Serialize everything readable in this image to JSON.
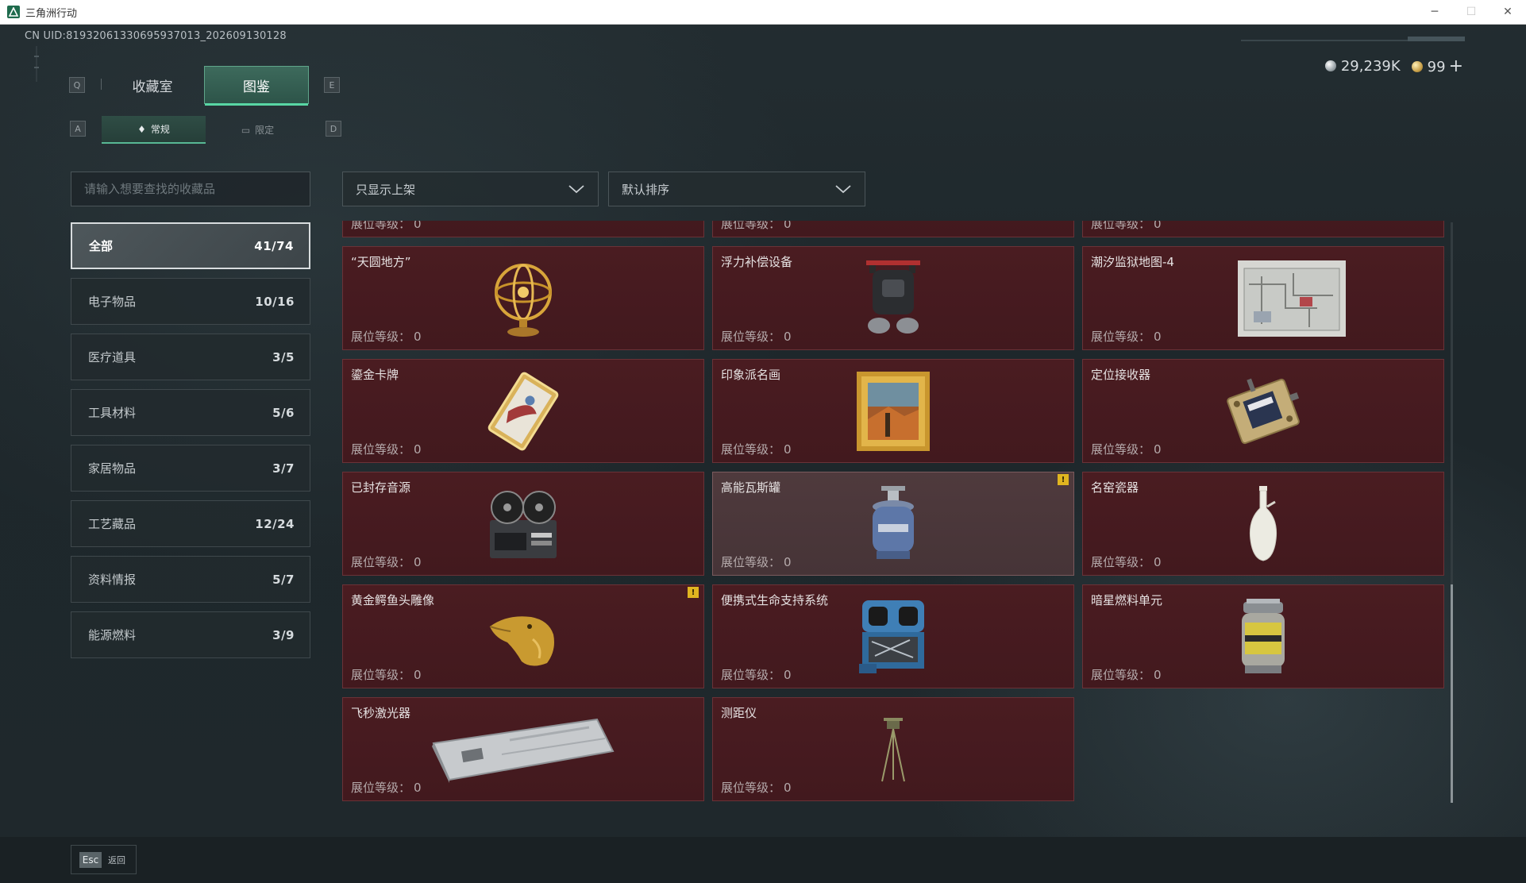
{
  "window": {
    "title": "三角洲行动",
    "controls": {
      "minimize": "─",
      "maximize": "☐",
      "close": "✕"
    }
  },
  "uid": "CN UID:81932061330695937013_202609130128",
  "currency": {
    "silver": "29,239K",
    "gold": "99",
    "add": "+"
  },
  "main_tabs": {
    "left_key": "Q",
    "right_key": "E",
    "items": [
      {
        "label": "收藏室",
        "active": false
      },
      {
        "label": "图鉴",
        "active": true
      }
    ]
  },
  "sub_tabs": {
    "left_key": "A",
    "right_key": "D",
    "items": [
      {
        "label": "常规",
        "icon": "item-icon",
        "active": true
      },
      {
        "label": "限定",
        "icon": "image-icon",
        "active": false
      }
    ]
  },
  "search": {
    "placeholder": "请输入想要查找的收藏品",
    "value": ""
  },
  "filters": {
    "shelf_filter": "只显示上架",
    "sort": "默认排序"
  },
  "categories": [
    {
      "label": "全部",
      "count": "41/74",
      "active": true
    },
    {
      "label": "电子物品",
      "count": "10/16"
    },
    {
      "label": "医疗道具",
      "count": "3/5"
    },
    {
      "label": "工具材料",
      "count": "5/6"
    },
    {
      "label": "家居物品",
      "count": "3/7"
    },
    {
      "label": "工艺藏品",
      "count": "12/24"
    },
    {
      "label": "资料情报",
      "count": "5/7"
    },
    {
      "label": "能源燃料",
      "count": "3/9"
    }
  ],
  "level_label": "展位等级：",
  "items": [
    {
      "name": "",
      "level": "0",
      "icon": "partial-item"
    },
    {
      "name": "",
      "level": "0",
      "icon": "partial-item"
    },
    {
      "name": "",
      "level": "0",
      "icon": "partial-item"
    },
    {
      "name": "“天圆地方”",
      "level": "0",
      "icon": "armillary-sphere-icon"
    },
    {
      "name": "浮力补偿设备",
      "level": "0",
      "icon": "buoyancy-device-icon"
    },
    {
      "name": "潮汐监狱地图-4",
      "level": "0",
      "icon": "map-icon"
    },
    {
      "name": "鎏金卡牌",
      "level": "0",
      "icon": "gold-card-icon"
    },
    {
      "name": "印象派名画",
      "level": "0",
      "icon": "painting-icon"
    },
    {
      "name": "定位接收器",
      "level": "0",
      "icon": "receiver-icon"
    },
    {
      "name": "已封存音源",
      "level": "0",
      "icon": "reel-recorder-icon"
    },
    {
      "name": "高能瓦斯罐",
      "level": "0",
      "icon": "gas-canister-icon",
      "badge": "!",
      "hover": true
    },
    {
      "name": "名窑瓷器",
      "level": "0",
      "icon": "porcelain-vase-icon"
    },
    {
      "name": "黄金鳄鱼头雕像",
      "level": "0",
      "icon": "crocodile-statue-icon",
      "badge": "!"
    },
    {
      "name": "便携式生命支持系统",
      "level": "0",
      "icon": "life-support-icon"
    },
    {
      "name": "暗星燃料单元",
      "level": "0",
      "icon": "fuel-cell-icon"
    },
    {
      "name": "飞秒激光器",
      "level": "0",
      "icon": "laser-device-icon"
    },
    {
      "name": "测距仪",
      "level": "0",
      "icon": "rangefinder-icon"
    }
  ],
  "footer": {
    "esc_key": "Esc",
    "back_label": "返回"
  },
  "colors": {
    "accent": "#58d6a4",
    "card_bg": "#4a1c21",
    "badge": "#e0b520"
  }
}
